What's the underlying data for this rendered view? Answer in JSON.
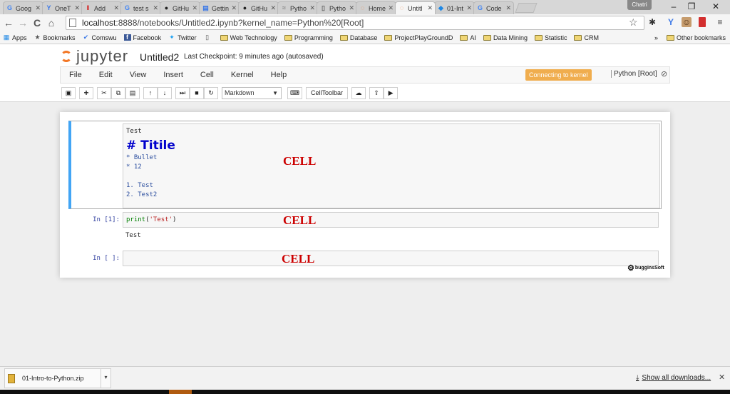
{
  "tabs": [
    {
      "title": "Goog",
      "icon": "google-icon"
    },
    {
      "title": "OneT",
      "icon": "yammer-icon"
    },
    {
      "title": "Add",
      "icon": "pause-icon"
    },
    {
      "title": "test s",
      "icon": "google-icon"
    },
    {
      "title": "GitHu",
      "icon": "github-icon"
    },
    {
      "title": "Gettin",
      "icon": "book-icon"
    },
    {
      "title": "GitHu",
      "icon": "github-icon"
    },
    {
      "title": "Pytho",
      "icon": "python-icon"
    },
    {
      "title": "Pytho",
      "icon": "page-icon"
    },
    {
      "title": "Home",
      "icon": "jupyter-icon"
    },
    {
      "title": "Untitl",
      "icon": "jupyter-icon",
      "active": true
    },
    {
      "title": "01-Int",
      "icon": "dropbox-icon"
    },
    {
      "title": "Code",
      "icon": "google-icon"
    }
  ],
  "window": {
    "profile": "Chatri",
    "minimize": "–",
    "restore": "❐",
    "close": "✕"
  },
  "nav": {
    "back": "←",
    "forward": "→",
    "reload": "C",
    "home": "⌂",
    "star": "☆",
    "menu": "≡"
  },
  "address": {
    "host": "localhost",
    "path": ":8888/notebooks/Untitled2.ipynb?kernel_name=Python%20[Root]"
  },
  "bookmarks": [
    {
      "label": "Apps",
      "icon": "apps-icon"
    },
    {
      "label": "Bookmarks",
      "icon": "star-icon"
    },
    {
      "label": "Comswu",
      "icon": "comswu-icon"
    },
    {
      "label": "Facebook",
      "icon": "facebook-icon"
    },
    {
      "label": "Twitter",
      "icon": "twitter-icon"
    },
    {
      "label": "",
      "icon": "page-icon"
    },
    {
      "label": "Web Technology",
      "icon": "folder-icon"
    },
    {
      "label": "Programming",
      "icon": "folder-icon"
    },
    {
      "label": "Database",
      "icon": "folder-icon"
    },
    {
      "label": "ProjectPlayGroundD",
      "icon": "folder-icon"
    },
    {
      "label": "AI",
      "icon": "folder-icon"
    },
    {
      "label": "Data Mining",
      "icon": "folder-icon"
    },
    {
      "label": "Statistic",
      "icon": "folder-icon"
    },
    {
      "label": "CRM",
      "icon": "folder-icon"
    }
  ],
  "bookmarks_overflow": "»",
  "other_bookmarks": "Other bookmarks",
  "jupyter": {
    "logo": "jupyter",
    "notebook_name": "Untitled2",
    "checkpoint": "Last Checkpoint: 9 minutes ago (autosaved)",
    "menus": [
      "File",
      "Edit",
      "View",
      "Insert",
      "Cell",
      "Kernel",
      "Help"
    ],
    "kernel_status": "Connecting to kernel",
    "kernel_name": "Python [Root]",
    "toolbar": {
      "save": "▣",
      "add": "+",
      "cut": "✂",
      "copy": "⧉",
      "paste": "▤",
      "up": "↑",
      "down": "↓",
      "run": "⏭",
      "stop": "■",
      "restart": "↻",
      "cell_type": "Markdown",
      "keyboard": "⌨",
      "celltoolbar": "CellToolbar",
      "upload": "☁",
      "publish": "⇪",
      "present": "▶"
    }
  },
  "cells": {
    "md": {
      "line1": "Test",
      "heading": "# Titile",
      "bullet1": "* Bullet",
      "bullet2": "* 12",
      "num1": "1. Test",
      "num2": "2. Test2"
    },
    "code1": {
      "prompt": "In [1]:",
      "fn": "print",
      "arg": "'Test'",
      "open": "(",
      "close": ")",
      "output": "Test"
    },
    "code2": {
      "prompt": "In [ ]:"
    },
    "annotation": "CELL"
  },
  "watermark": "bugginsSoft",
  "download": {
    "file": "01-Intro-to-Python.zip",
    "show_all": "Show all downloads...",
    "close": "✕"
  }
}
